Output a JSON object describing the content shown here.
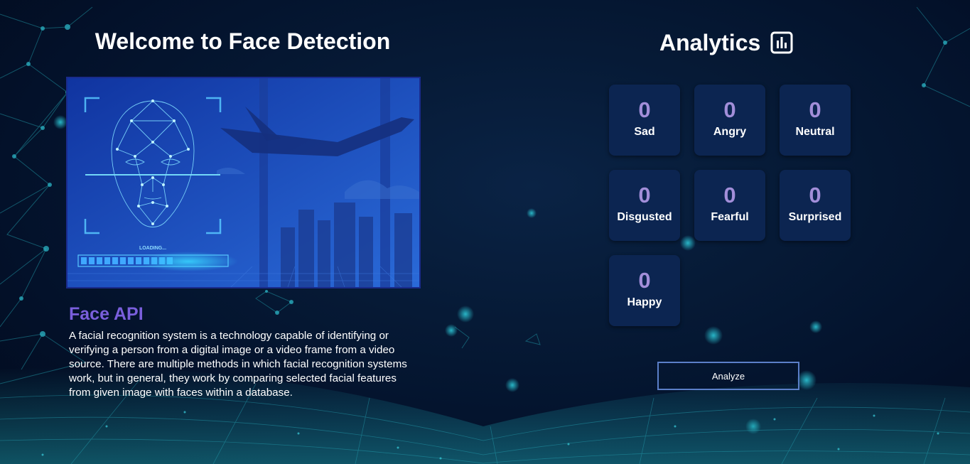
{
  "welcome": {
    "title": "Welcome to Face Detection"
  },
  "hero": {
    "loading_text": "LOADING..."
  },
  "face_api": {
    "title": "Face API",
    "description": "A facial recognition system is a technology capable of identifying or verifying a person from a digital image or a video frame from a video source. There are multiple methods in which facial recognition systems work, but in general, they work by comparing selected facial features from given image with faces within a database."
  },
  "analytics": {
    "title": "Analytics",
    "icon": "bar-chart-icon",
    "emotions": [
      {
        "label": "Sad",
        "count": "0"
      },
      {
        "label": "Angry",
        "count": "0"
      },
      {
        "label": "Neutral",
        "count": "0"
      },
      {
        "label": "Disgusted",
        "count": "0"
      },
      {
        "label": "Fearful",
        "count": "0"
      },
      {
        "label": "Surprised",
        "count": "0"
      },
      {
        "label": "Happy",
        "count": "0"
      }
    ],
    "analyze_label": "Analyze"
  },
  "colors": {
    "background": "#03112a",
    "card": "#0c2551",
    "count": "#a28ed9",
    "accent": "#7a5fdc",
    "button_border": "#5b7fc9",
    "network": "#1f9aa8"
  }
}
